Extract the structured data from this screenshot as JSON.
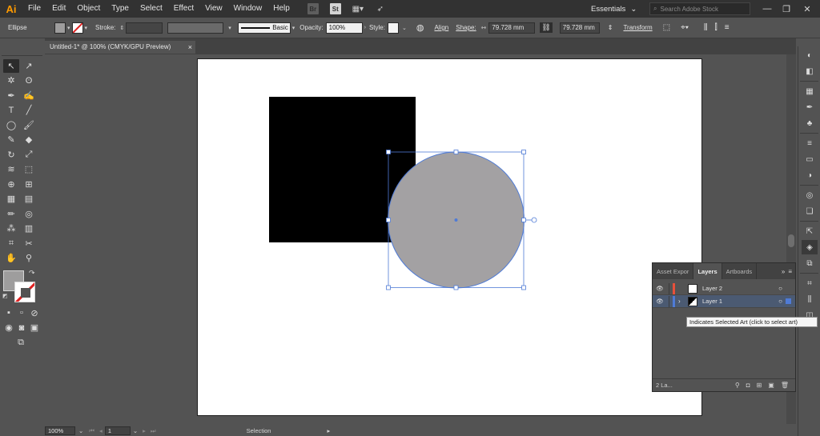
{
  "menubar": {
    "logo": "Ai",
    "items": [
      "File",
      "Edit",
      "Object",
      "Type",
      "Select",
      "Effect",
      "View",
      "Window",
      "Help"
    ],
    "bridge_icon": "Br",
    "stock_icon": "St",
    "workspace": "Essentials",
    "search_placeholder": "Search Adobe Stock"
  },
  "controlbar": {
    "selection_name": "Ellipse",
    "fill_color": "#9e9d9d",
    "stroke_label": "Stroke:",
    "brush_label": "Basic",
    "opacity_label": "Opacity:",
    "opacity_value": "100%",
    "style_label": "Style:",
    "align_label": "Align",
    "shape_label": "Shape:",
    "width_value": "79.728 mm",
    "height_value": "79.728 mm",
    "transform_label": "Transform"
  },
  "document": {
    "tab_title": "Untitled-1* @ 100% (CMYK/GPU Preview)",
    "close_label": "×"
  },
  "artwork": {
    "square_color": "#000000",
    "circle_color": "#a3a1a3",
    "selection_color": "#4f7bd6"
  },
  "layers_panel": {
    "tabs": [
      "Asset Expor",
      "Layers",
      "Artboards"
    ],
    "active_tab": "Layers",
    "layers": [
      {
        "name": "Layer 2",
        "color": "#e8503a",
        "selected": false
      },
      {
        "name": "Layer 1",
        "color": "#4f7bd6",
        "selected": true
      }
    ],
    "footer_count": "2 La...",
    "tooltip": "Indicates Selected Art (click to select art)"
  },
  "statusbar": {
    "zoom": "100%",
    "artboard_number": "1",
    "tool_name": "Selection"
  }
}
